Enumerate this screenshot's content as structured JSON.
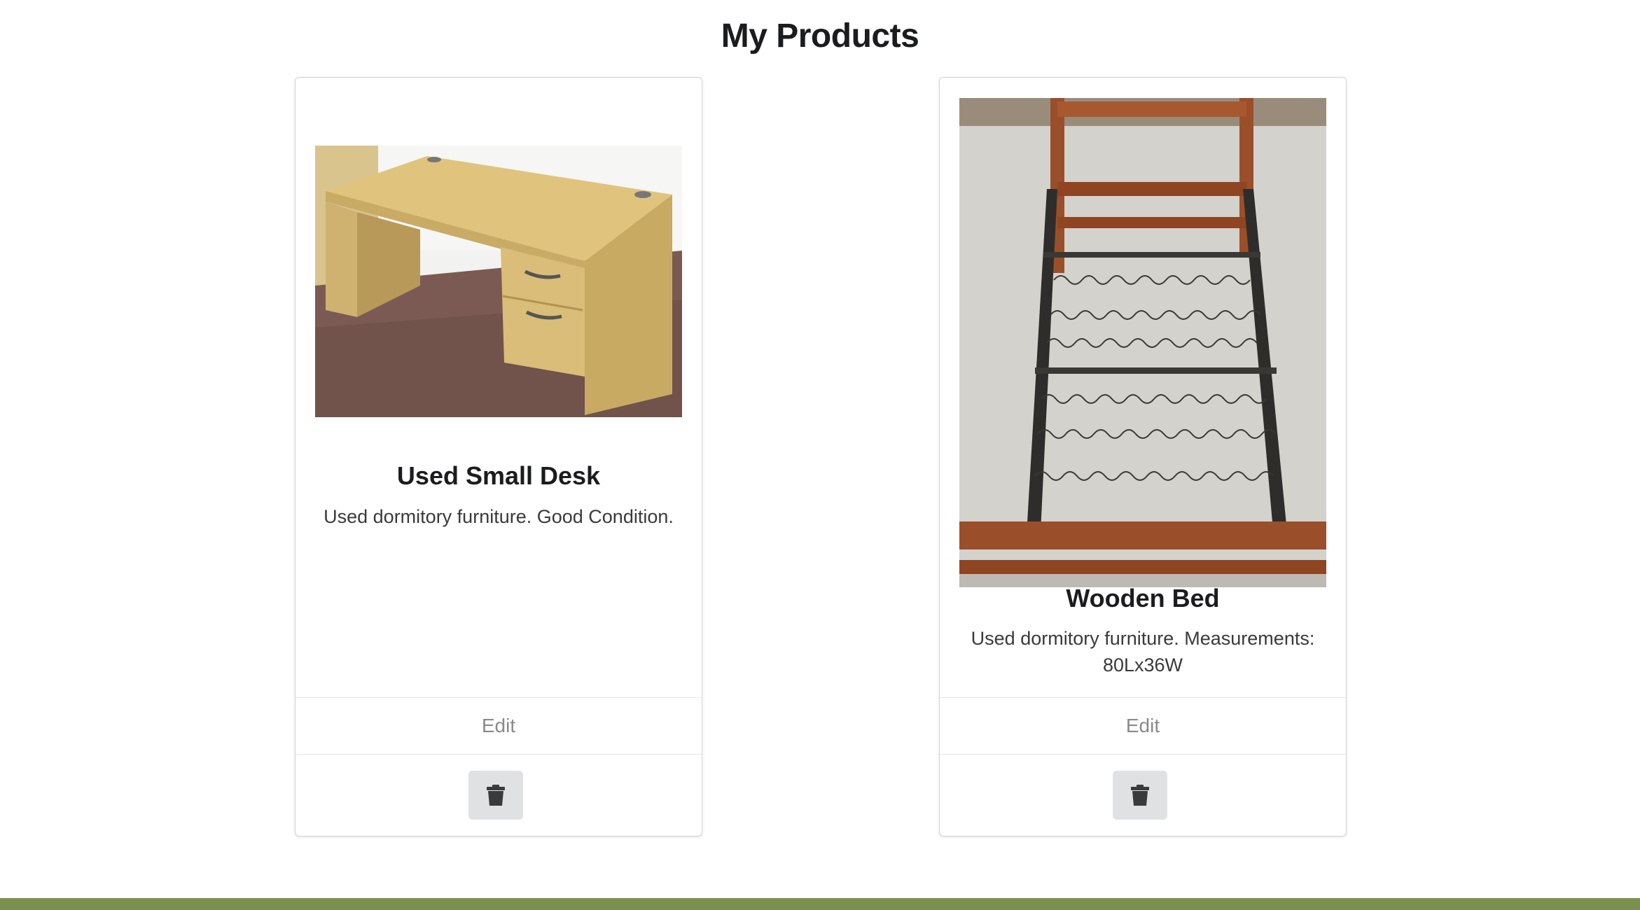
{
  "page": {
    "title": "My Products"
  },
  "products": [
    {
      "name": "Used Small Desk",
      "description": "Used dormitory furniture. Good Condition.",
      "image_icon": "desk-photo",
      "edit_label": "Edit",
      "delete_icon": "trash-icon"
    },
    {
      "name": "Wooden Bed",
      "description": "Used dormitory furniture. Measurements: 80Lx36W",
      "image_icon": "bed-frame-photo",
      "edit_label": "Edit",
      "delete_icon": "trash-icon"
    }
  ],
  "colors": {
    "footer_accent": "#7b8f4f",
    "delete_button_bg": "#e0e1e2",
    "edit_text": "#8a8a8a"
  }
}
